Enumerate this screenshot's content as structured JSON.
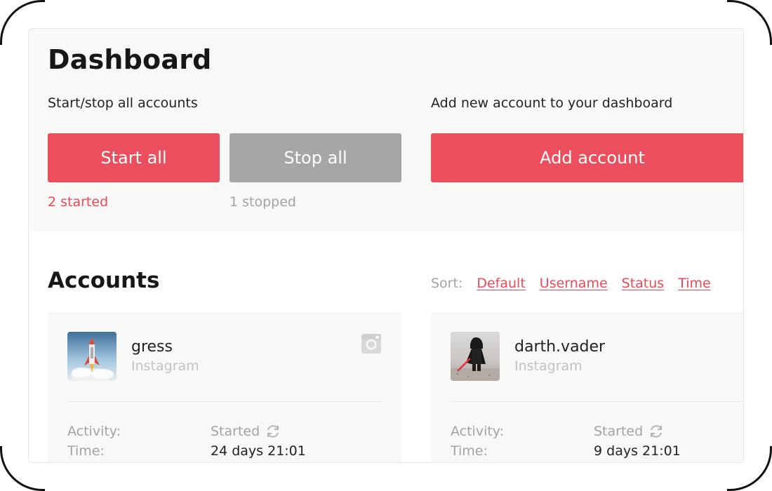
{
  "header": {
    "title": "Dashboard",
    "start_stop_label": "Start/stop all accounts",
    "add_label": "Add new account to your dashboard",
    "start_button": "Start all",
    "stop_button": "Stop all",
    "add_button": "Add account",
    "started_count": "2 started",
    "stopped_count": "1 stopped"
  },
  "accounts": {
    "title": "Accounts",
    "sort_label": "Sort:",
    "sort_options": [
      "Default",
      "Username",
      "Status",
      "Time"
    ],
    "cards": [
      {
        "username": "gress",
        "network": "Instagram",
        "avatar": "rocket-launch-photo",
        "network_icon": "instagram-icon",
        "activity_label": "Activity:",
        "activity_value": "Started",
        "time_label": "Time:",
        "time_value": "24 days 21:01"
      },
      {
        "username": "darth.vader",
        "network": "Instagram",
        "avatar": "darth-vader-toy-photo",
        "activity_label": "Activity:",
        "activity_value": "Started",
        "time_label": "Time:",
        "time_value": "9 days 21:01"
      }
    ]
  },
  "colors": {
    "accent": "#eb4f5d",
    "stop_button": "#a6a6a5",
    "panel": "#f8f8f7",
    "muted_text": "#a3a3a3"
  }
}
